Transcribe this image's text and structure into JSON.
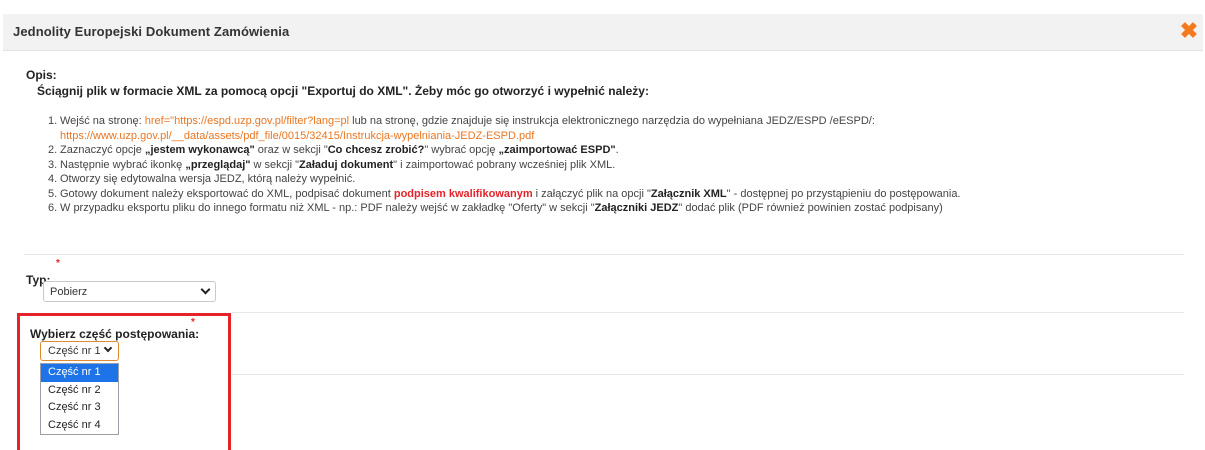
{
  "dialog": {
    "title": "Jednolity Europejski Dokument Zamówienia",
    "close_glyph": "✖"
  },
  "description": {
    "label": "Opis:",
    "heading": "Ściągnij plik w formacie XML za pomocą opcji \"Exportuj do XML\". Żeby móc go otworzyć i wypełnić należy:",
    "steps": {
      "s1": {
        "num": "1.",
        "a": "Wejść na stronę: ",
        "link1": "href=\"https://espd.uzp.gov.pl/filter?lang=pl",
        "b": " lub na stronę, gdzie znajduje się instrukcja elektronicznego narzędzia do wypełniana JEDZ/ESPD /eESPD/:",
        "link2": "https://www.uzp.gov.pl/__data/assets/pdf_file/0015/32415/Instrukcja-wypelniania-JEDZ-ESPD.pdf"
      },
      "s2": {
        "num": "2.",
        "a": "Zaznaczyć opcje ",
        "b1": "„jestem wykonawcą\"",
        "c": " oraz w sekcji \"",
        "b2": "Co chcesz zrobić?",
        "d": "\" wybrać opcję ",
        "b3": "„zaimportować ESPD\"",
        "e": "."
      },
      "s3": {
        "num": "3.",
        "a": "Następnie wybrać ikonkę ",
        "b1": "„przeglądaj\"",
        "c": " w sekcji \"",
        "b2": "Załaduj dokument",
        "d": "\" i zaimportować pobrany wcześniej plik XML."
      },
      "s4": {
        "num": "4.",
        "a": "Otworzy się edytowalna wersja JEDZ, którą należy wypełnić."
      },
      "s5": {
        "num": "5.",
        "a": "Gotowy dokument należy eksportować do XML, podpisać dokument ",
        "red": "podpisem kwalifikowanym",
        "b": " i załączyć plik na opcji \"",
        "b1": "Załącznik XML",
        "c": "\" - dostępnej po przystąpieniu do postępowania."
      },
      "s6": {
        "num": "6.",
        "a": "W przypadku eksportu pliku do innego formatu niż XML - np.: PDF należy wejść w zakładkę \"Oferty\" w sekcji \"",
        "b1": "Załączniki JEDZ",
        "c": "\" dodać plik (PDF również powinien zostać podpisany)"
      }
    }
  },
  "typ": {
    "label": "Typ:",
    "required_mark": "*",
    "selected": "Pobierz"
  },
  "part": {
    "label": "Wybierz część postępowania:",
    "required_mark": "*",
    "selected": "Część nr 1",
    "options": [
      "Część nr 1",
      "Część nr 2",
      "Część nr 3",
      "Część nr 4"
    ]
  },
  "colors": {
    "accent_orange": "#f47a20",
    "link_orange": "#e87722",
    "required_red": "#e4232a",
    "selected_option_blue": "#1e73e8",
    "highlight_red": "#e4232a"
  }
}
